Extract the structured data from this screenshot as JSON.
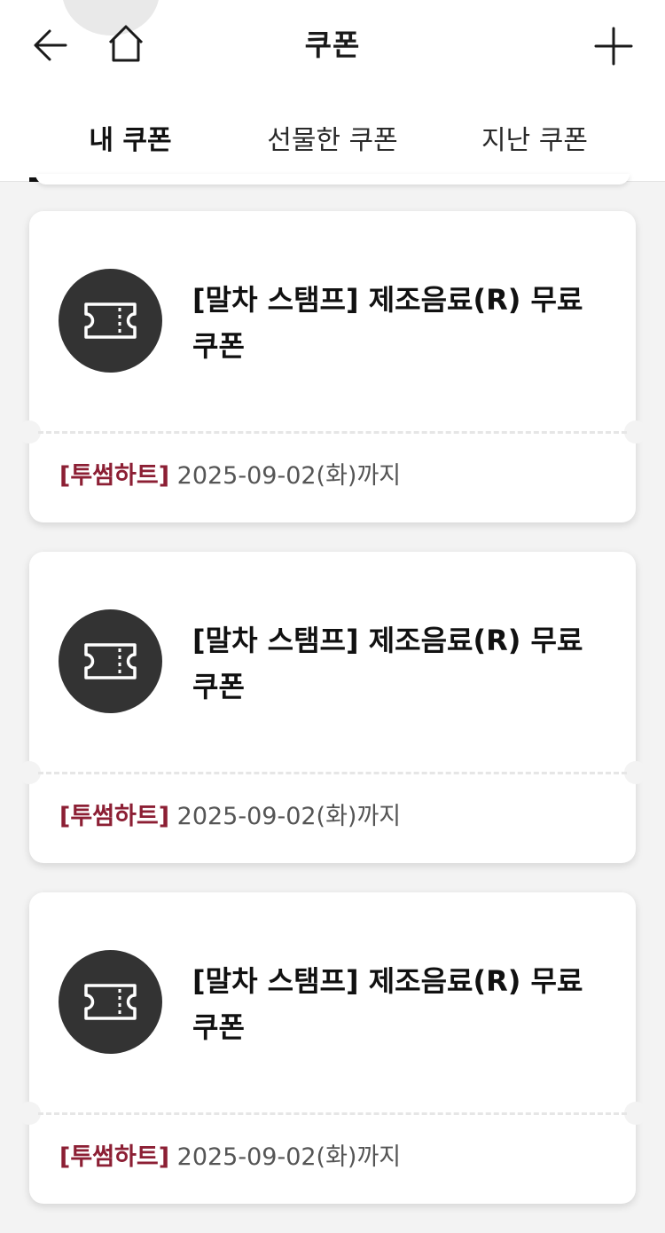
{
  "header": {
    "title": "쿠폰",
    "back_icon": "arrow-left-icon",
    "home_icon": "home-icon",
    "add_icon": "plus-icon"
  },
  "tabs": [
    {
      "label": "내 쿠폰",
      "active": true
    },
    {
      "label": "선물한 쿠폰",
      "active": false
    },
    {
      "label": "지난 쿠폰",
      "active": false
    }
  ],
  "coupons": [
    {
      "icon": "ticket-icon",
      "title": "[말차 스탬프] 제조음료(R) 무료 쿠폰",
      "brand": "[투썸하트]",
      "expiry": "2025-09-02(화)까지"
    },
    {
      "icon": "ticket-icon",
      "title": "[말차 스탬프] 제조음료(R) 무료 쿠폰",
      "brand": "[투썸하트]",
      "expiry": "2025-09-02(화)까지"
    },
    {
      "icon": "ticket-icon",
      "title": "[말차 스탬프] 제조음료(R) 무료 쿠폰",
      "brand": "[투썸하트]",
      "expiry": "2025-09-02(화)까지"
    }
  ],
  "colors": {
    "brand_text": "#8c1f34",
    "icon_circle": "#333333",
    "background": "#f3f3f3",
    "active_tab_underline": "#111111"
  }
}
